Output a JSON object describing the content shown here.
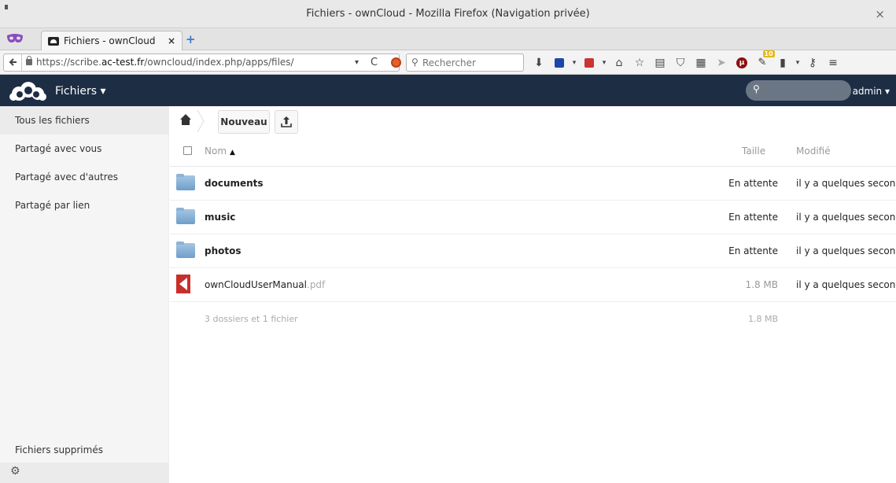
{
  "window": {
    "title": "Fichiers - ownCloud - Mozilla Firefox (Navigation privée)",
    "close": "×"
  },
  "tabs": [
    {
      "label": "Fichiers - ownCloud",
      "close": "×"
    }
  ],
  "newtab": "+",
  "urlbar": {
    "url_prefix": "https://scribe.",
    "url_host": "ac-test.fr",
    "url_path": "/owncloud/index.php/apps/files/",
    "dropdown": "▾",
    "reload": "C"
  },
  "searchbar": {
    "placeholder": "Rechercher"
  },
  "toolbar_icons": [
    "download-icon",
    "save-icon",
    "pocket-plus-icon",
    "home-icon",
    "bookmark-star-icon",
    "reading-list-icon",
    "pocket-icon",
    "grid-icon",
    "send-icon",
    "ublock-icon",
    "notifications-icon",
    "battery-icon",
    "extension-icon",
    "menu-icon"
  ],
  "toolbar_badge": "10",
  "app": {
    "name": "Fichiers ▾",
    "user": "admin ▾",
    "header_color": "#1d2d44"
  },
  "sidebar": {
    "items": [
      {
        "label": "Tous les fichiers",
        "active": true
      },
      {
        "label": "Partagé avec vous"
      },
      {
        "label": "Partagé avec d'autres"
      },
      {
        "label": "Partagé par lien"
      }
    ],
    "trash": "Fichiers supprimés"
  },
  "controls": {
    "new_button": "Nouveau"
  },
  "table": {
    "headers": {
      "name": "Nom",
      "size": "Taille",
      "modified": "Modifié"
    },
    "sort_arrow": "▲",
    "rows": [
      {
        "type": "folder",
        "name": "documents",
        "ext": "",
        "size": "En attente",
        "modified": "il y a quelques secon..."
      },
      {
        "type": "folder",
        "name": "music",
        "ext": "",
        "size": "En attente",
        "modified": "il y a quelques secon..."
      },
      {
        "type": "folder",
        "name": "photos",
        "ext": "",
        "size": "En attente",
        "modified": "il y a quelques secon..."
      },
      {
        "type": "pdf",
        "name": "ownCloudUserManual",
        "ext": ".pdf",
        "size": "1.8 MB",
        "modified": "il y a quelques secon..."
      }
    ],
    "summary": {
      "text": "3 dossiers et 1 fichier",
      "size": "1.8 MB"
    }
  }
}
